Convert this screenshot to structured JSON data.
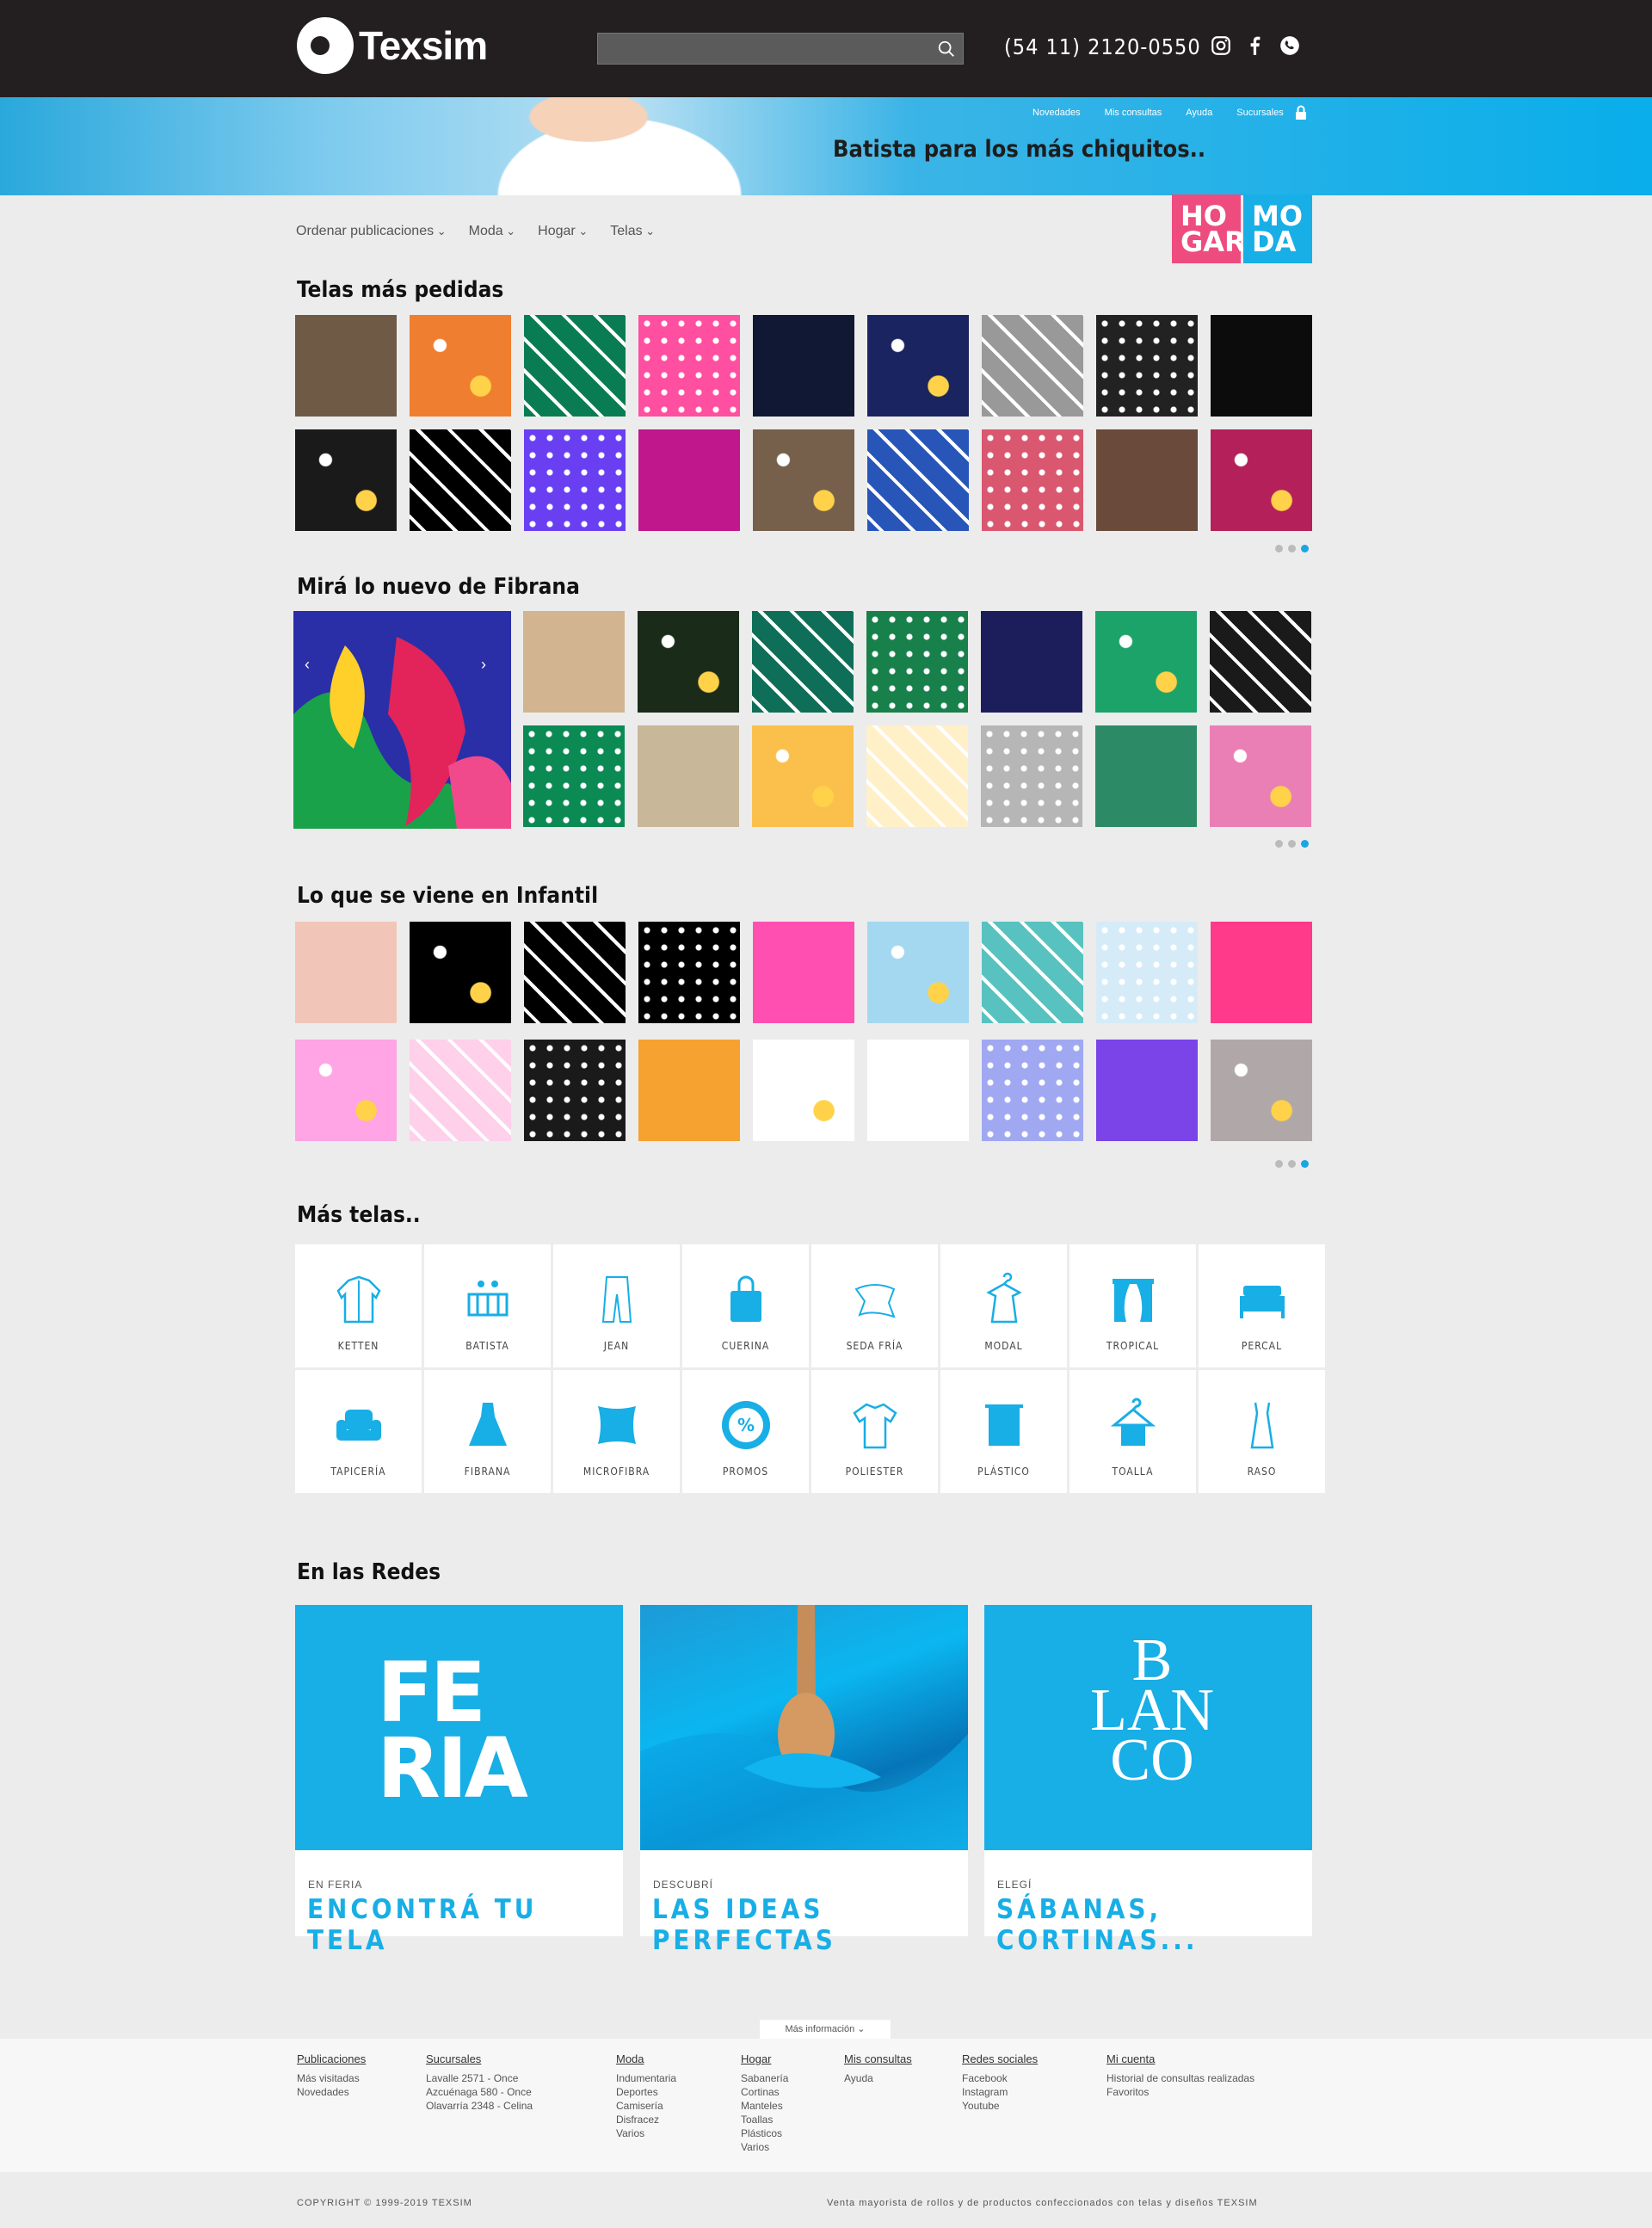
{
  "header": {
    "logo_text": "Texsim",
    "search_placeholder": "",
    "phone": "(54 11) 2120-0550"
  },
  "banner": {
    "links": [
      "Novedades",
      "Mis consultas",
      "Ayuda",
      "Sucursales"
    ],
    "title": "Batista para los más chiquitos.."
  },
  "filters": [
    "Ordenar publicaciones",
    "Moda",
    "Hogar",
    "Telas"
  ],
  "hogar_moda": {
    "hogar": "HO GAR",
    "moda": "MO DA"
  },
  "sections": {
    "mas_pedidas": "Telas más pedidas",
    "fibrana": "Mirá lo nuevo de Fibrana",
    "infantil": "Lo que se viene en Infantil",
    "mas_telas": "Más telas..",
    "redes": "En las Redes"
  },
  "swatch_colors": {
    "mas_pedidas": [
      "#6e5a45",
      "#f07e30",
      "#0a7c54",
      "#ff4fa0",
      "#111833",
      "#1a2460",
      "#999",
      "#222",
      "#0c0c0c",
      "#1a1a1a",
      "#000",
      "#6a3ff2",
      "#c0188c",
      "#76604c",
      "#2855b8",
      "#d9576f",
      "#6a4a3a",
      "#b4205a"
    ],
    "fibrana": [
      "#d2b490",
      "#1a2b1a",
      "#0e6e58",
      "#18804a",
      "#1c1e5c",
      "#1ba36a",
      "#1a1a1a",
      "#0b8a54",
      "#c9b799",
      "#fbc04c",
      "#fff0c8",
      "#b6b6b6",
      "#2d8a66",
      "#ea7fb5"
    ],
    "infantil": [
      "#f1c6b8",
      "#000",
      "#000",
      "#000",
      "#ff4fb0",
      "#a4d8f0",
      "#58c2c0",
      "#d5ecf8",
      "#ff3a8a",
      "#ffa4e4",
      "#ffd0ea",
      "#1a1a1a",
      "#f6a230",
      "#fff",
      "#fff",
      "#a0a8f2",
      "#7a44e8",
      "#b0a8a8"
    ]
  },
  "categories": [
    {
      "label": "KETTEN",
      "icon": "jacket-icon"
    },
    {
      "label": "BATISTA",
      "icon": "crib-icon"
    },
    {
      "label": "JEAN",
      "icon": "jeans-icon"
    },
    {
      "label": "CUERINA",
      "icon": "bag-icon"
    },
    {
      "label": "SEDA FRÍA",
      "icon": "scarf-icon"
    },
    {
      "label": "MODAL",
      "icon": "dress-hanger-icon"
    },
    {
      "label": "TROPICAL",
      "icon": "curtain-icon"
    },
    {
      "label": "PERCAL",
      "icon": "bed-icon"
    },
    {
      "label": "TAPICERÍA",
      "icon": "armchair-icon"
    },
    {
      "label": "FIBRANA",
      "icon": "dress-icon"
    },
    {
      "label": "MICROFIBRA",
      "icon": "pillow-icon"
    },
    {
      "label": "PROMOS",
      "icon": "percent-icon"
    },
    {
      "label": "POLIESTER",
      "icon": "tshirt-icon"
    },
    {
      "label": "PLÁSTICO",
      "icon": "shower-curtain-icon"
    },
    {
      "label": "TOALLA",
      "icon": "towel-hanger-icon"
    },
    {
      "label": "RASO",
      "icon": "nightgown-icon"
    }
  ],
  "cards": [
    {
      "img_text": "FE RIA",
      "pre": "EN FERIA",
      "cta": "ENCONTRÁ TU TELA"
    },
    {
      "img_text": "",
      "pre": "DESCUBRÍ",
      "cta": "LAS IDEAS PERFECTAS"
    },
    {
      "img_text": "B LAN CO",
      "pre": "ELEGÍ",
      "cta": "SÁBANAS, CORTINAS..."
    }
  ],
  "footer": {
    "more": "Más información",
    "cols": [
      {
        "title": "Publicaciones",
        "items": [
          "Más visitadas",
          "Novedades"
        ]
      },
      {
        "title": "Sucursales",
        "items": [
          "Lavalle 2571 - Once",
          "Azcuénaga 580 - Once",
          "Olavarría 2348 - Celina"
        ]
      },
      {
        "title": "Moda",
        "items": [
          "Indumentaria",
          "Deportes",
          "Camisería",
          "Disfracez",
          "Varios"
        ]
      },
      {
        "title": "Hogar",
        "items": [
          "Sabanería",
          "Cortinas",
          "Manteles",
          "Toallas",
          "Plásticos",
          "Varios"
        ]
      },
      {
        "title": "Mis consultas",
        "items": [
          "Ayuda"
        ]
      },
      {
        "title": "Redes sociales",
        "items": [
          "Facebook",
          "Instagram",
          "Youtube"
        ]
      },
      {
        "title": "Mi cuenta",
        "items": [
          "Historial de consultas realizadas",
          "Favoritos"
        ]
      }
    ],
    "copyright": "COPYRIGHT © 1999-2019 TEXSIM",
    "tagline": "Venta mayorista de rollos y de productos confeccionados con telas y diseños TEXSIM"
  },
  "colors": {
    "accent": "#18aee6",
    "hogar": "#ee4b7f",
    "topbar": "#231f20"
  }
}
